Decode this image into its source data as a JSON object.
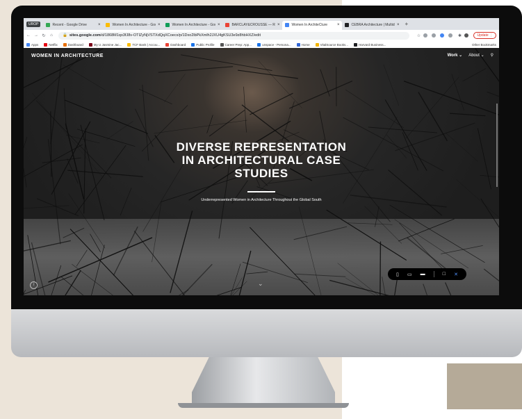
{
  "browser": {
    "badge": "UROP",
    "tabs": [
      {
        "label": "Recent - Google Drive",
        "color": "#34a853",
        "active": false
      },
      {
        "label": "Women In Architecture - Goog",
        "color": "#fbbc04",
        "active": false
      },
      {
        "label": "Women In Architecture - Goog",
        "color": "#0f9d58",
        "active": false
      },
      {
        "label": "BARCLAY&CROUSSE — RED",
        "color": "#ea4335",
        "active": false
      },
      {
        "label": "Women In ArchiteCture",
        "color": "#4285f4",
        "active": true
      },
      {
        "label": "CEBRA Architecture | Multidisc",
        "color": "#202124",
        "active": false
      }
    ],
    "new_tab": "+",
    "url_host": "sites.google.com",
    "url_path": "/d/1868M1qo3fJ8v-OTIZyNjVSTXdQqXCoecx/p/1Dxo2lbPkXmlh2JXU4gKSU3e9z8hbHXZ/edit",
    "update_label": "Update",
    "bookmarks": [
      {
        "label": "Apps",
        "color": "#4285f4"
      },
      {
        "label": "Netflix",
        "color": "#e50914"
      },
      {
        "label": "Dashboard",
        "color": "#e8710a"
      },
      {
        "label": "My U Jasmine Jac...",
        "color": "#7a0019"
      },
      {
        "label": "TCF Bank | Accou...",
        "color": "#fbbc04"
      },
      {
        "label": "Dashboard",
        "color": "#ea4335"
      },
      {
        "label": "Public Profile",
        "color": "#1a73e8"
      },
      {
        "label": "Career Prep: App...",
        "color": "#555555"
      },
      {
        "label": "unspace - Persona...",
        "color": "#1a73e8"
      },
      {
        "label": "Home",
        "color": "#3367d6"
      },
      {
        "label": "VitalSource Books...",
        "color": "#f4b400"
      },
      {
        "label": "Harvard Business...",
        "color": "#202124"
      }
    ],
    "other_bookmarks": "Other Bookmarks"
  },
  "site": {
    "title": "WOMEN IN ARCHITECTURE",
    "nav_work": "Work ⌄",
    "nav_about": "About ⌄",
    "hero_line1": "DIVERSE REPRESENTATION",
    "hero_line2": "IN ARCHITECTURAL CASE",
    "hero_line3": "STUDIES",
    "subtitle": "Underrepresented Women in Architecture Throughout the Global South"
  }
}
